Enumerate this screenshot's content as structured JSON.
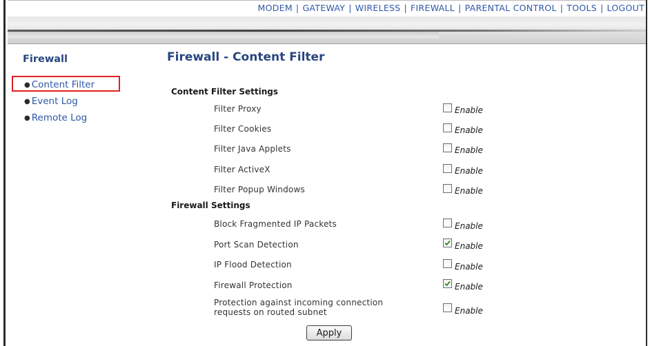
{
  "nav": {
    "items": [
      "MODEM",
      "GATEWAY",
      "WIRELESS",
      "FIREWALL",
      "PARENTAL CONTROL",
      "TOOLS",
      "LOGOUT"
    ],
    "separator": "|"
  },
  "sidebar": {
    "title": "Firewall",
    "items": [
      {
        "label": "Content Filter",
        "highlighted": true
      },
      {
        "label": "Event Log"
      },
      {
        "label": "Remote Log"
      }
    ]
  },
  "main": {
    "title": "Firewall - Content Filter",
    "sections": [
      {
        "heading": "Content Filter Settings",
        "rows": [
          {
            "label": "Filter Proxy",
            "checked": false,
            "option": "Enable"
          },
          {
            "label": "Filter Cookies",
            "checked": false,
            "option": "Enable"
          },
          {
            "label": "Filter Java Applets",
            "checked": false,
            "option": "Enable"
          },
          {
            "label": "Filter ActiveX",
            "checked": false,
            "option": "Enable"
          },
          {
            "label": "Filter Popup Windows",
            "checked": false,
            "option": "Enable"
          }
        ]
      },
      {
        "heading": "Firewall Settings",
        "rows": [
          {
            "label": "Block Fragmented IP Packets",
            "checked": false,
            "option": "Enable"
          },
          {
            "label": "Port Scan Detection",
            "checked": true,
            "option": "Enable"
          },
          {
            "label": "IP Flood Detection",
            "checked": false,
            "option": "Enable"
          },
          {
            "label": "Firewall Protection",
            "checked": true,
            "option": "Enable"
          },
          {
            "label_line1": "Protection against incoming connection",
            "label_line2": "requests on routed subnet",
            "checked": false,
            "option": "Enable"
          }
        ]
      }
    ],
    "apply_label": "Apply"
  },
  "colors": {
    "link": "#2f57a6",
    "heading": "#28467f",
    "highlight_box": "#e02020",
    "check": "#2a8a1f"
  }
}
